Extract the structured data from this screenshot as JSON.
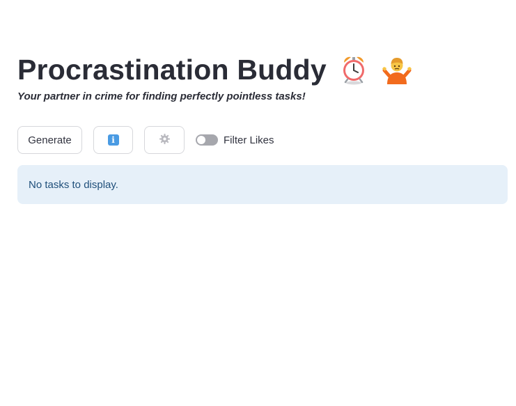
{
  "header": {
    "title": "Procrastination Buddy",
    "title_icons": [
      "alarm-clock-icon",
      "person-shrugging-icon"
    ],
    "subtitle": "Your partner in crime for finding perfectly pointless tasks!"
  },
  "toolbar": {
    "generate_label": "Generate",
    "info_icon": "info-icon",
    "settings_icon": "gear-icon",
    "filter_toggle": {
      "label": "Filter Likes",
      "checked": false
    }
  },
  "tasks": {
    "empty_message": "No tasks to display."
  },
  "colors": {
    "alert_background": "#e6f0f9",
    "alert_text": "#1f4f7a",
    "info_blue": "#4a9be3",
    "toggle_off": "#a6a7ad"
  }
}
